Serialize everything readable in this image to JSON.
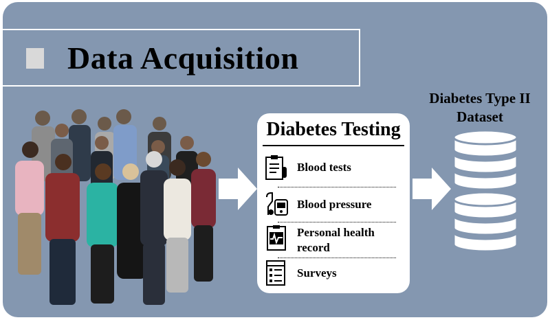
{
  "title": "Data Acquisition",
  "testing": {
    "title": "Diabetes Testing",
    "items": [
      {
        "label_lines": [
          "Blood tests"
        ],
        "icon": "clipboard-icon"
      },
      {
        "label_lines": [
          "Blood pressure"
        ],
        "icon": "blood-pressure-monitor-icon"
      },
      {
        "label_lines": [
          "Personal health",
          "record"
        ],
        "icon": "health-record-icon"
      },
      {
        "label_lines": [
          "Surveys"
        ],
        "icon": "survey-checklist-icon"
      }
    ]
  },
  "dataset": {
    "title_line1": "Diabetes Type II",
    "title_line2": "Dataset"
  },
  "colors": {
    "panel": "#8497b0",
    "title_square": "#d9d9d9",
    "box": "#ffffff"
  }
}
